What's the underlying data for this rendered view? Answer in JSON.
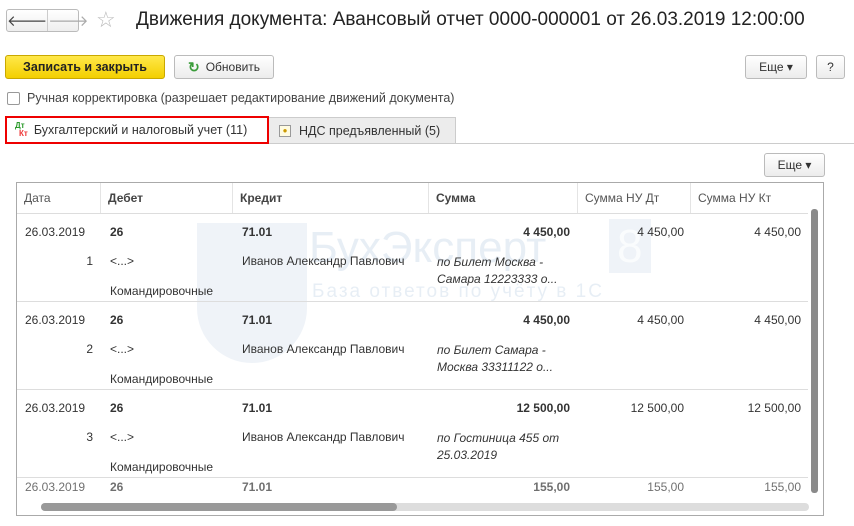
{
  "window": {
    "title": "Движения документа: Авансовый отчет 0000-000001 от 26.03.2019 12:00:00"
  },
  "toolbar": {
    "save_close": "Записать и закрыть",
    "refresh": "Обновить",
    "more": "Еще ▾",
    "help": "?"
  },
  "manual_correction": {
    "label": "Ручная корректировка (разрешает редактирование движений документа)",
    "checked": false
  },
  "tabs": [
    {
      "label": "Бухгалтерский и налоговый учет (11)",
      "icon_top": "Дт",
      "icon_bottom": "Кт",
      "active": true
    },
    {
      "label": "НДС предъявленный (5)",
      "active": false
    }
  ],
  "grid_toolbar": {
    "more": "Еще ▾"
  },
  "watermark": {
    "brand": "БухЭксперт",
    "digit": "8",
    "tagline": "База ответов по учёту в 1С"
  },
  "table": {
    "columns": [
      "Дата",
      "Дебет",
      "Кредит",
      "Сумма",
      "Сумма НУ Дт",
      "Сумма НУ Кт"
    ],
    "rows": [
      {
        "date": "26.03.2019",
        "num": "1",
        "debit": "26",
        "debit_sub1": "<...>",
        "debit_sub2": "Командировочные",
        "credit": "71.01",
        "credit_sub": "Иванов Александр Павлович",
        "sum": "4 450,00",
        "desc": "по Билет Москва - Самара 12223333 о...",
        "nu_dt": "4 450,00",
        "nu_kt": "4 450,00"
      },
      {
        "date": "26.03.2019",
        "num": "2",
        "debit": "26",
        "debit_sub1": "<...>",
        "debit_sub2": "Командировочные",
        "credit": "71.01",
        "credit_sub": "Иванов Александр Павлович",
        "sum": "4 450,00",
        "desc": "по Билет Самара - Москва 33311122 о...",
        "nu_dt": "4 450,00",
        "nu_kt": "4 450,00"
      },
      {
        "date": "26.03.2019",
        "num": "3",
        "debit": "26",
        "debit_sub1": "<...>",
        "debit_sub2": "Командировочные",
        "credit": "71.01",
        "credit_sub": "Иванов Александр Павлович",
        "sum": "12 500,00",
        "desc": "по Гостиница 455 от 25.03.2019",
        "nu_dt": "12 500,00",
        "nu_kt": "12 500,00"
      },
      {
        "date": "26.03.2019",
        "debit": "26",
        "credit": "71.01",
        "sum": "155,00",
        "nu_dt": "155,00",
        "nu_kt": "155,00"
      }
    ]
  }
}
